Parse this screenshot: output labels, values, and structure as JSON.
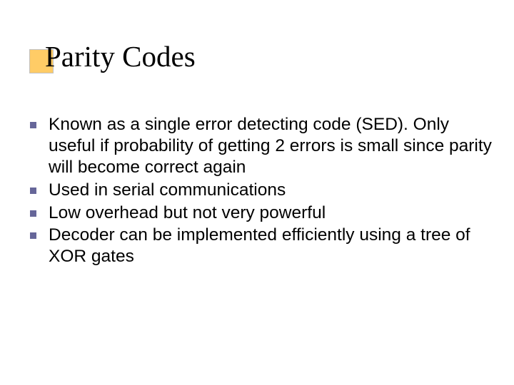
{
  "slide": {
    "title": "Parity Codes",
    "bullets": [
      "Known as a single error detecting code (SED). Only useful if probability of getting 2 errors is small since parity will become correct again",
      "Used in serial communications",
      "Low overhead but not very powerful",
      "Decoder can be implemented efficiently using a tree of XOR gates"
    ]
  }
}
